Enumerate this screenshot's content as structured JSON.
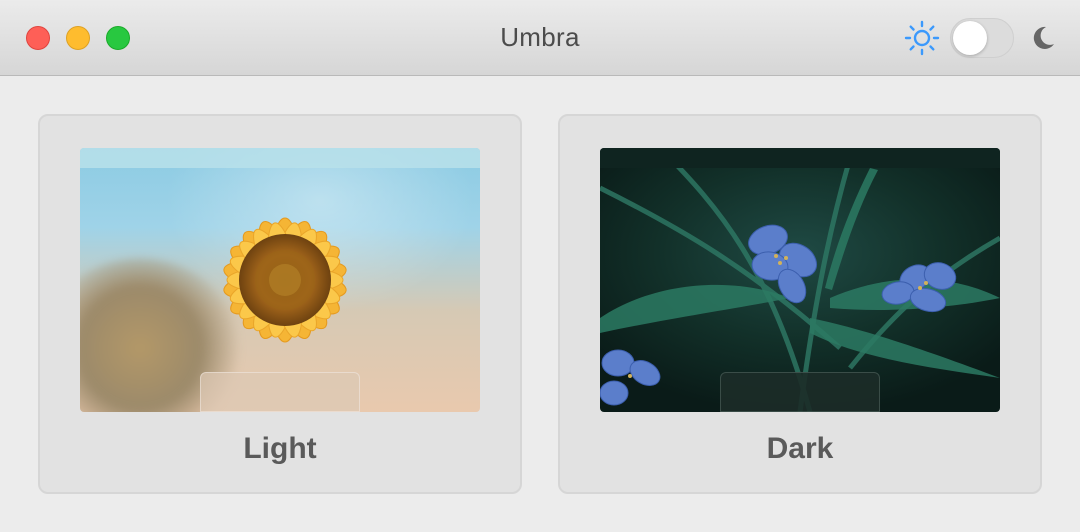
{
  "window": {
    "title": "Umbra"
  },
  "appearance_toggle": {
    "state": "off",
    "left_icon": "sun-icon",
    "right_icon": "moon-icon",
    "accent": "#3b99fc"
  },
  "options": [
    {
      "label": "Light",
      "preview": "sunflower-wallpaper"
    },
    {
      "label": "Dark",
      "preview": "blue-flowers-wallpaper"
    }
  ]
}
